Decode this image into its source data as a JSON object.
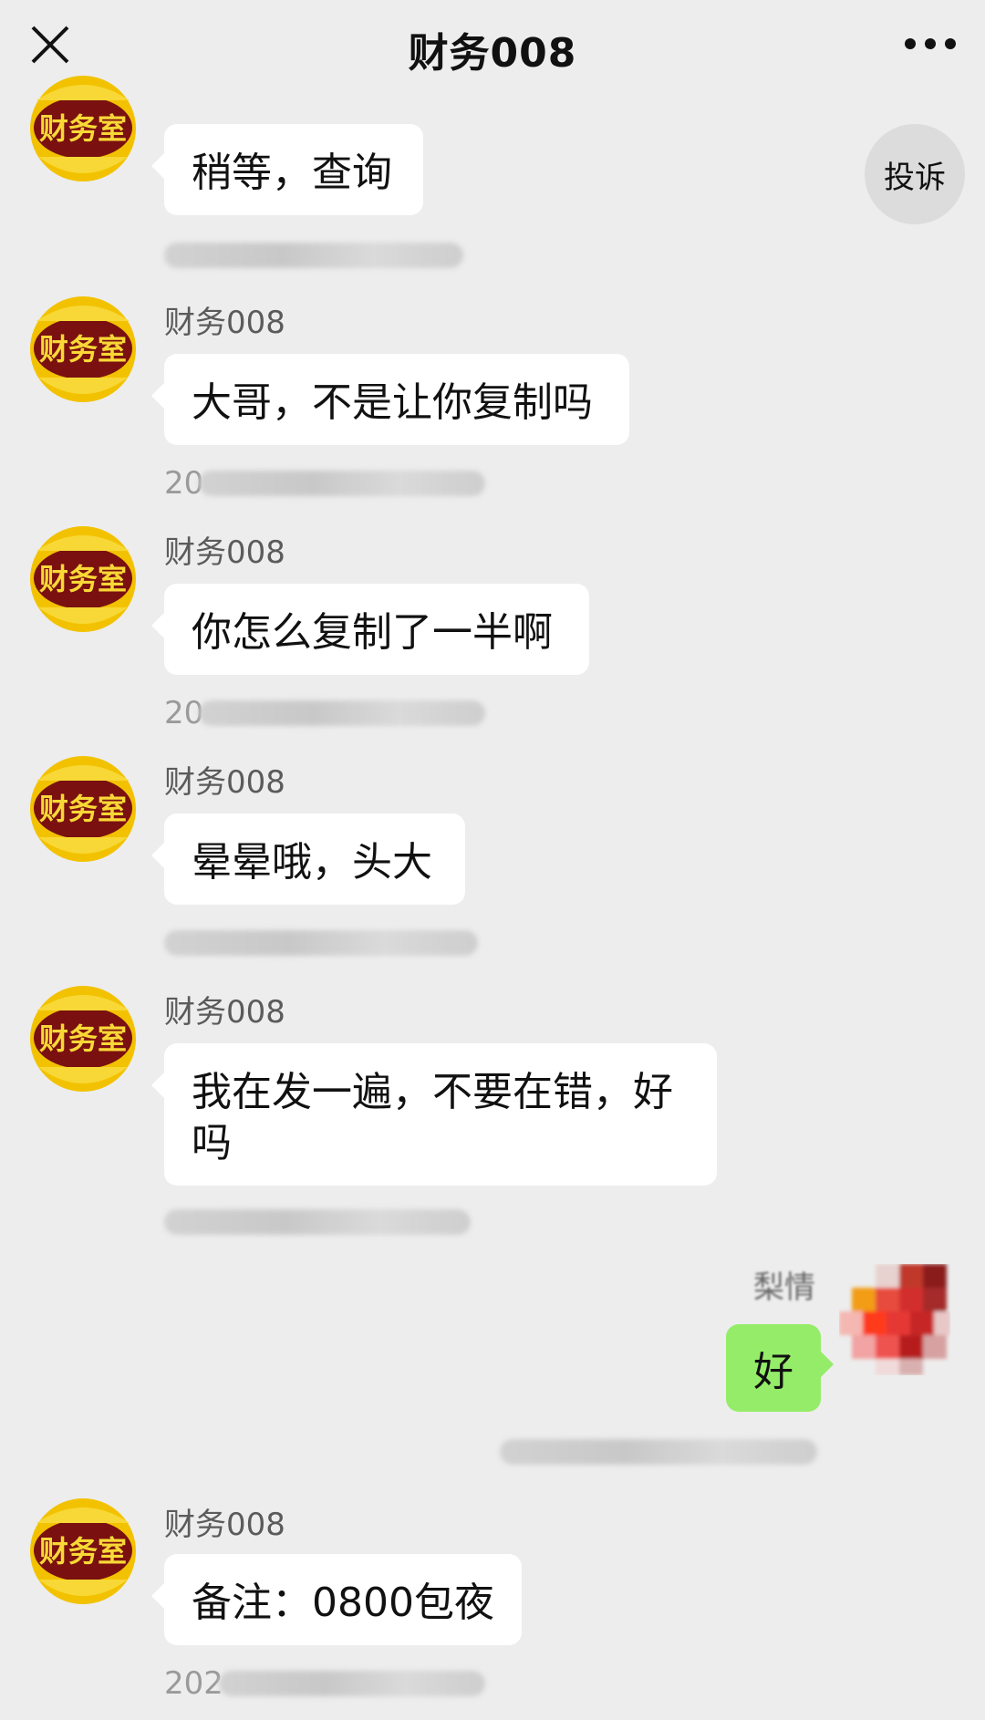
{
  "header": {
    "title": "财务008"
  },
  "complaint_label": "投诉",
  "avatar_label": "财务室",
  "messages": [
    {
      "sender": "",
      "text": "稍等，查询"
    },
    {
      "sender": "财务008",
      "text": "大哥，不是让你复制吗",
      "ts": "20"
    },
    {
      "sender": "财务008",
      "text": "你怎么复制了一半啊",
      "ts": "20"
    },
    {
      "sender": "财务008",
      "text": "晕晕哦，头大"
    },
    {
      "sender": "财务008",
      "text": "我在发一遍，不要在错，好吗"
    },
    {
      "sender": "财务008",
      "text": "备注：0800包夜",
      "ts": "202"
    }
  ],
  "self": {
    "name": "梨情",
    "text": "好"
  },
  "colors": {
    "background": "#ededed",
    "bubble_other": "#ffffff",
    "bubble_self": "#95ec69",
    "avatar_red": "#7a1010",
    "avatar_gold": "#f2c200"
  }
}
